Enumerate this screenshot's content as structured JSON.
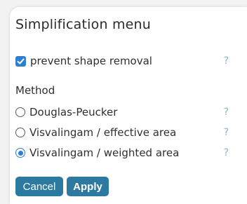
{
  "menu": {
    "title": "Simplification menu",
    "prevent_shape_removal": {
      "label": "prevent shape removal",
      "checked": true,
      "help": "?"
    },
    "method": {
      "label": "Method",
      "options": [
        {
          "label": "Douglas-Peucker",
          "selected": false,
          "help": "?"
        },
        {
          "label": "Visvalingam / effective area",
          "selected": false,
          "help": "?"
        },
        {
          "label": "Visvalingam / weighted area",
          "selected": true,
          "help": "?"
        }
      ]
    },
    "buttons": {
      "cancel": "Cancel",
      "apply": "Apply"
    }
  },
  "colors": {
    "accent": "#2f7fd1",
    "button": "#2d7aa0",
    "help": "#8fb3cc"
  }
}
